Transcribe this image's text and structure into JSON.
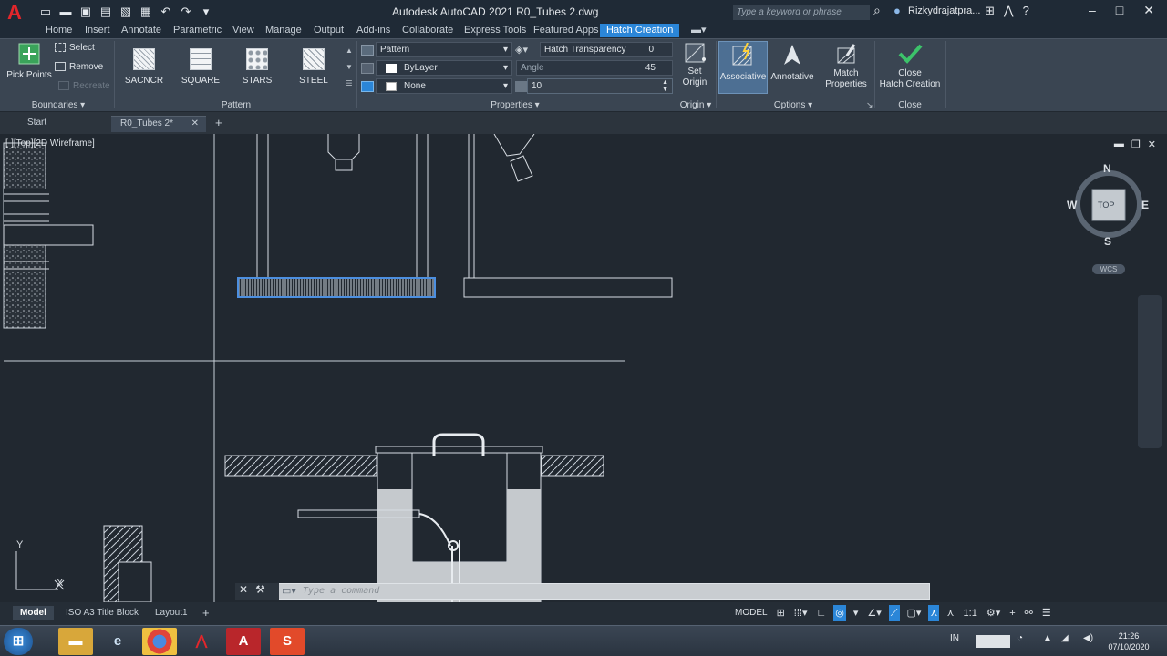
{
  "titlebar": {
    "app_letter": "A",
    "title": "Autodesk AutoCAD 2021    R0_Tubes 2.dwg",
    "search_placeholder": "Type a keyword or phrase",
    "user": "Rizkydrajatpra..."
  },
  "menu_tabs": [
    "Home",
    "Insert",
    "Annotate",
    "Parametric",
    "View",
    "Manage",
    "Output",
    "Add-ins",
    "Collaborate",
    "Express Tools",
    "Featured Apps",
    "Hatch Creation"
  ],
  "ribbon": {
    "boundaries": {
      "pick_points": "Pick Points",
      "select": "Select",
      "remove": "Remove",
      "recreate": "Recreate",
      "label": "Boundaries"
    },
    "pattern": {
      "tiles": [
        "SACNCR",
        "SQUARE",
        "STARS",
        "STEEL"
      ],
      "label": "Pattern"
    },
    "properties": {
      "hatch_type": "Pattern",
      "hatch_transparency_label": "Hatch Transparency",
      "hatch_transparency_value": "0",
      "color": "ByLayer",
      "angle_label": "Angle",
      "angle_value": "45",
      "background": "None",
      "scale_value": "10",
      "label": "Properties"
    },
    "origin": {
      "set_origin": "Set\nOrigin",
      "label": "Origin"
    },
    "options": {
      "associative": "Associative",
      "annotative": "Annotative",
      "match_properties": "Match\nProperties",
      "label": "Options"
    },
    "close": {
      "close_hatch": "Close\nHatch Creation",
      "label": "Close"
    }
  },
  "doc_tabs": {
    "start": "Start",
    "current": "R0_Tubes 2*"
  },
  "viewport": {
    "label": "[-][Top][2D Wireframe]",
    "compass": {
      "n": "N",
      "s": "S",
      "e": "E",
      "w": "W",
      "face": "TOP"
    },
    "wcs": "WCS",
    "ucs_y": "Y",
    "ucs_x": "X"
  },
  "command": {
    "placeholder": "Type a command"
  },
  "layout_tabs": [
    "Model",
    "ISO A3 Title Block",
    "Layout1"
  ],
  "status": {
    "model": "MODEL",
    "scale": "1:1"
  },
  "taskbar": {
    "lang": "IN",
    "time": "21:26",
    "date": "07/10/2020"
  },
  "colors": {
    "ribbon_bg": "#3a4552",
    "canvas_bg": "#212830",
    "accent": "#2b86d8",
    "close_check": "#3cc36a"
  }
}
